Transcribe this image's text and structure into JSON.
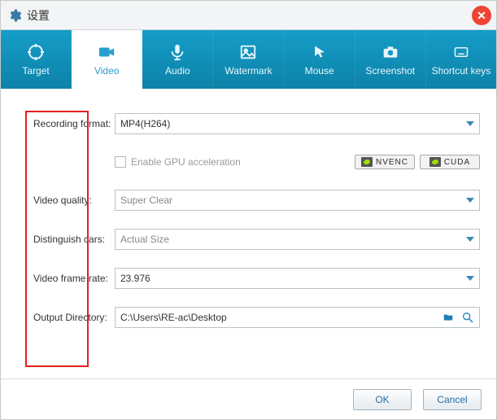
{
  "window": {
    "title": "设置"
  },
  "tabs": [
    {
      "id": "target",
      "label": "Target",
      "icon": "target-icon"
    },
    {
      "id": "video",
      "label": "Video",
      "icon": "video-icon",
      "active": true
    },
    {
      "id": "audio",
      "label": "Audio",
      "icon": "mic-icon"
    },
    {
      "id": "watermark",
      "label": "Watermark",
      "icon": "image-icon"
    },
    {
      "id": "mouse",
      "label": "Mouse",
      "icon": "cursor-icon"
    },
    {
      "id": "screenshot",
      "label": "Screenshot",
      "icon": "camera-icon"
    },
    {
      "id": "shortcut",
      "label": "Shortcut keys",
      "icon": "keyboard-icon"
    }
  ],
  "form": {
    "recording_format": {
      "label": "Recording format:",
      "value": "MP4(H264)"
    },
    "gpu": {
      "label": "Enable GPU acceleration",
      "checked": false,
      "badges": [
        "NVENC",
        "CUDA"
      ]
    },
    "video_quality": {
      "label": "Video quality:",
      "value": "Super Clear"
    },
    "distinguish": {
      "label": "Distinguish cars:",
      "value": "Actual Size"
    },
    "frame_rate": {
      "label": "Video frame rate:",
      "value": "23.976"
    },
    "output_dir": {
      "label": "Output Directory:",
      "value": "C:\\Users\\RE-ac\\Desktop"
    }
  },
  "footer": {
    "ok": "OK",
    "cancel": "Cancel"
  }
}
